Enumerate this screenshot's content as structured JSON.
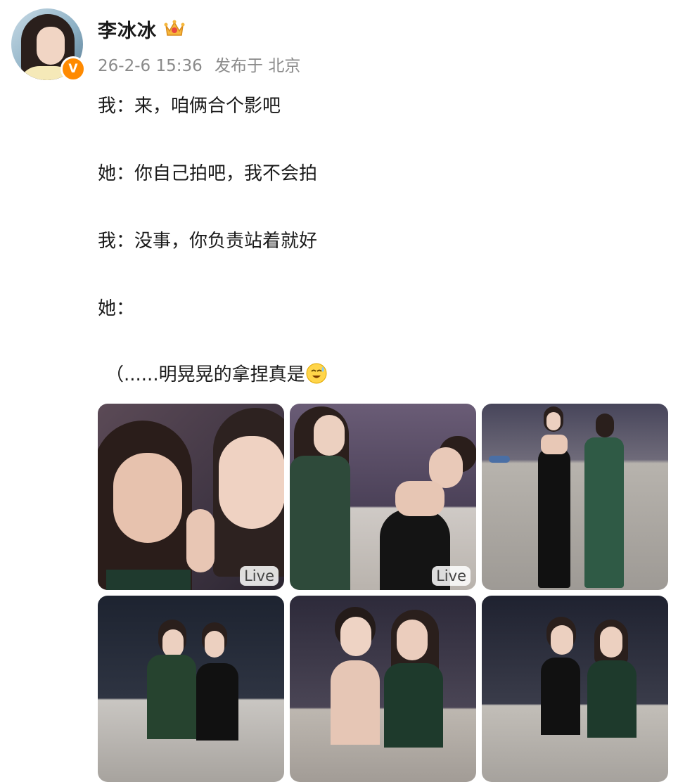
{
  "author": {
    "name": "李冰冰",
    "crown_icon": "crown-icon",
    "verified_badge": "V",
    "verified_color": "#ff8a00"
  },
  "post": {
    "timestamp": "26-2-6 15:36",
    "location_text": "发布于 北京",
    "lines": [
      "我：来，咱俩合个影吧",
      "她：你自己拍吧，我不会拍",
      "我：没事，你负责站着就好",
      "她：",
      "（......明晃晃的拿捏真是"
    ],
    "trailing_emoji": "laughing-sweat-emoji"
  },
  "images": [
    {
      "badge": "Live"
    },
    {
      "badge": "Live"
    },
    {
      "badge": ""
    },
    {
      "badge": ""
    },
    {
      "badge": ""
    },
    {
      "badge": ""
    }
  ]
}
